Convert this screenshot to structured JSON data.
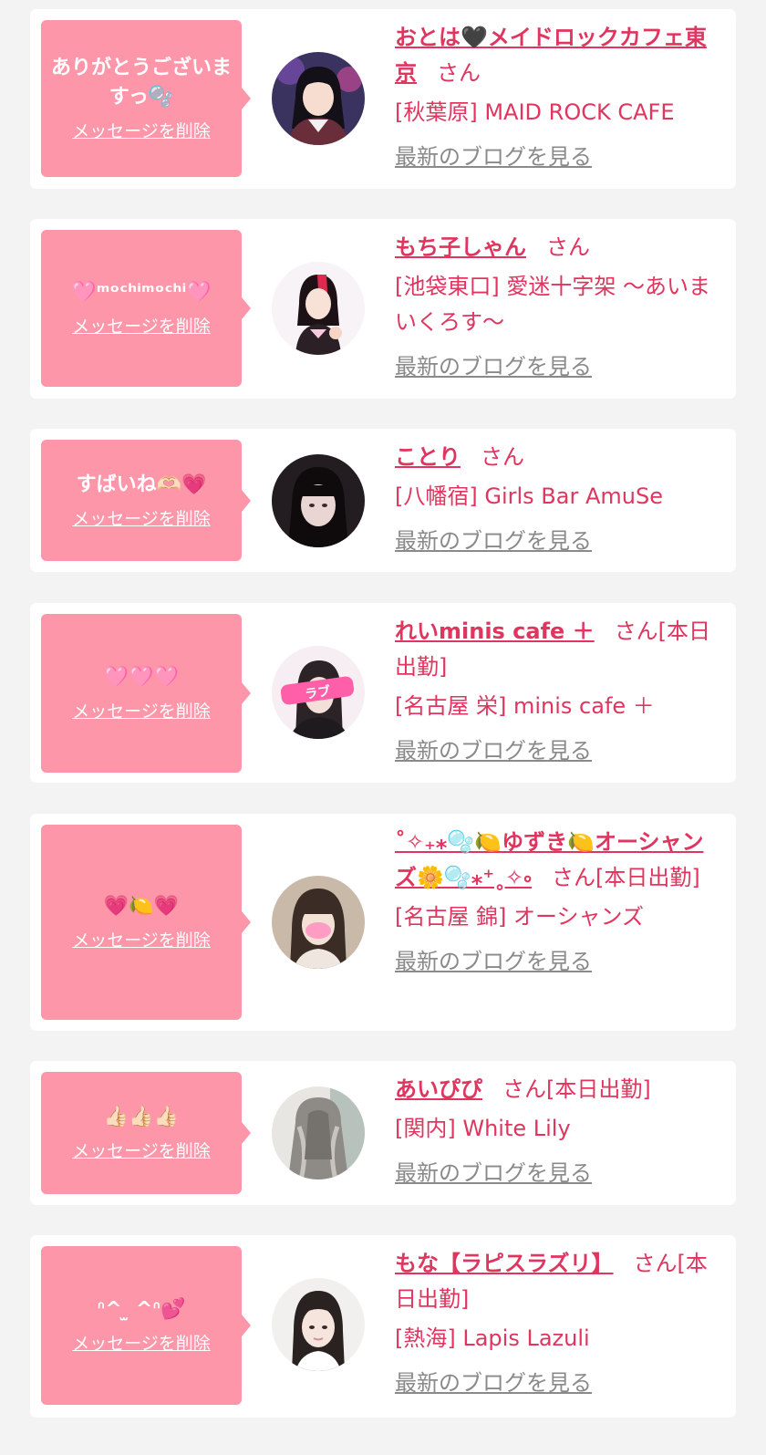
{
  "colors": {
    "accent": "#e0355f",
    "bubble": "#fc96a8",
    "link_gray": "#8a8a8a",
    "background": "#f3f3f3",
    "card": "#ffffff"
  },
  "cards": [
    {
      "message": "ありがとうございますっ🫧",
      "delete_label": "メッセージを削除",
      "name": "おとは🖤メイドロックカフェ東京",
      "suffix": "さん",
      "shop": "[秋葉原] MAID ROCK CAFE",
      "blog_label": "最新のブログを見る"
    },
    {
      "message": "🩷ᵐᵒᶜʰⁱᵐᵒᶜʰⁱ🩷",
      "delete_label": "メッセージを削除",
      "name": "もち子しゃん",
      "suffix": "さん",
      "shop": "[池袋東口] 愛迷十字架 〜あいまいくろす〜",
      "blog_label": "最新のブログを見る"
    },
    {
      "message": "すばいね🫶🏻💗",
      "delete_label": "メッセージを削除",
      "name": "ことり",
      "suffix": "さん",
      "shop": "[八幡宿] Girls Bar AmuSe",
      "blog_label": "最新のブログを見る"
    },
    {
      "message": "🩷🩷🩷",
      "delete_label": "メッセージを削除",
      "name": "れいminis cafe ＋",
      "suffix": "さん[本日出勤]",
      "shop": "[名古屋 栄] minis cafe ＋",
      "blog_label": "最新のブログを見る"
    },
    {
      "message": "💗🍋💗",
      "delete_label": "メッセージを削除",
      "name": "˚✧₊⁎🫧🍋ゆずき🍋オーシャンズ🌼🫧⁎⁺˳✧༚",
      "suffix": "さん[本日出勤]",
      "shop": "[名古屋 錦] オーシャンズ",
      "blog_label": "最新のブログを見る"
    },
    {
      "message": "👍🏻👍🏻👍🏻",
      "delete_label": "メッセージを削除",
      "name": "あいぴぴ",
      "suffix": "さん[本日出勤]",
      "shop": "[関内] White Lily",
      "blog_label": "最新のブログを見る"
    },
    {
      "message": "ᐢ^ ̫ ^ᐢ💕",
      "delete_label": "メッセージを削除",
      "name": "もな【ラピスラズリ】",
      "suffix": "さん[本日出勤]",
      "shop": "[熱海] Lapis Lazuli",
      "blog_label": "最新のブログを見る"
    }
  ]
}
